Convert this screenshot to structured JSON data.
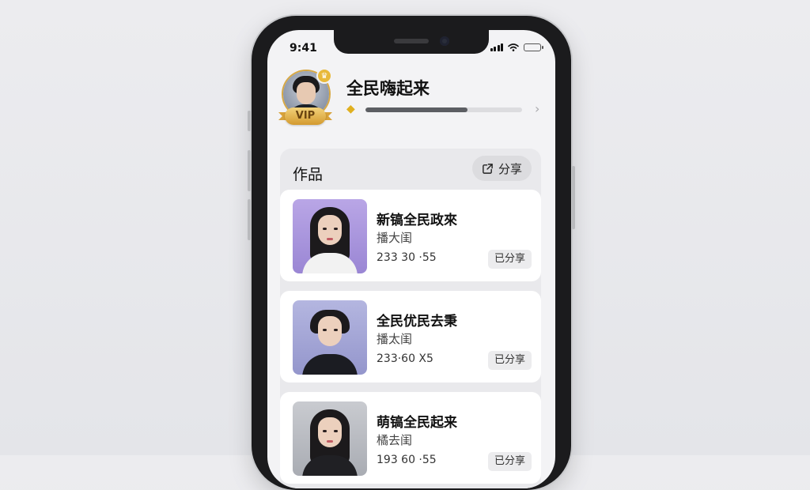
{
  "status_bar": {
    "time": "9:41",
    "icons": [
      "signal-icon",
      "wifi-icon",
      "battery-icon"
    ]
  },
  "profile": {
    "username": "全民嗨起来",
    "vip_label": "VIP",
    "level_progress": 0.65,
    "avatar_badge_icon": "crown-icon",
    "level_icon": "diamond-icon"
  },
  "works": {
    "title": "作品",
    "share_label": "分享",
    "items": [
      {
        "title": "新镐全民政來",
        "subtitle": "播大闺",
        "meta": "233 30 ·55",
        "badge": "已分享"
      },
      {
        "title": "全民优民去秉",
        "subtitle": "播太闺",
        "meta": "233·60 X5",
        "badge": "已分享"
      },
      {
        "title": "萌镐全民起来",
        "subtitle": "橘去闺",
        "meta": "193 60 ·55",
        "badge": "已分享"
      }
    ]
  },
  "colors": {
    "accent_gold": "#d39a2f",
    "background": "#ececef",
    "card": "#ffffff"
  }
}
